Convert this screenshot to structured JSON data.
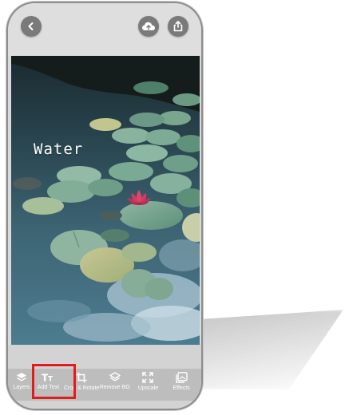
{
  "header": {
    "back_icon": "chevron-left-icon",
    "cloud_icon": "cloud-upload-icon",
    "share_icon": "share-icon"
  },
  "canvas": {
    "overlay_text": "Water",
    "photo_subject": "water-lily-pond"
  },
  "toolbar": {
    "items": [
      {
        "label": "Layers",
        "icon": "layers-icon"
      },
      {
        "label": "Add Text",
        "icon": "text-icon"
      },
      {
        "label": "Crop & Rotate",
        "icon": "crop-icon"
      },
      {
        "label": "Remove BG",
        "icon": "remove-bg-icon"
      },
      {
        "label": "Upscale",
        "icon": "upscale-icon"
      },
      {
        "label": "Effects",
        "icon": "effects-icon"
      }
    ],
    "highlighted": "Add Text",
    "highlight_color": "#e21b1b"
  },
  "colors": {
    "button_gray": "#7a7a7a",
    "toolbar_bg": "#bdbdbd",
    "header_bg": "#dedede"
  }
}
